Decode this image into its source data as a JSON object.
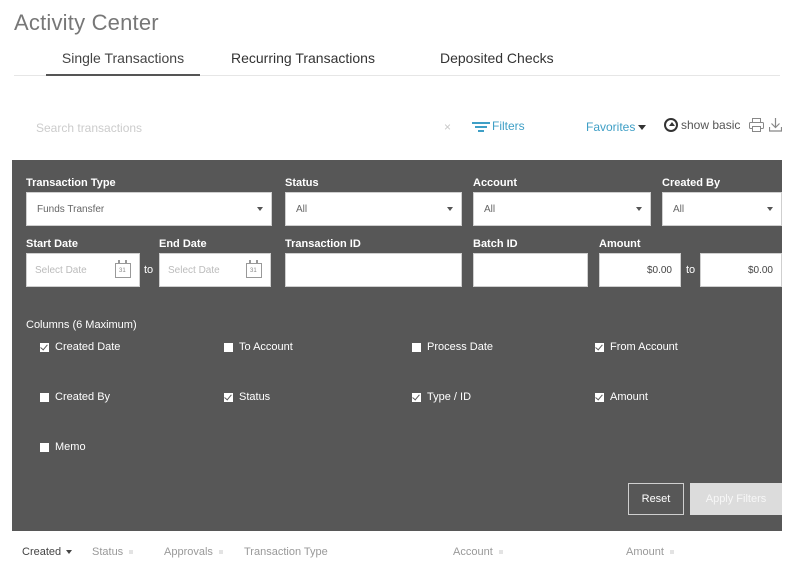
{
  "page": {
    "title": "Activity Center"
  },
  "tabs": [
    {
      "label": "Single Transactions",
      "active": true
    },
    {
      "label": "Recurring Transactions",
      "active": false
    },
    {
      "label": "Deposited Checks",
      "active": false
    }
  ],
  "toolbar": {
    "search_placeholder": "Search transactions",
    "clear_symbol": "×",
    "filters_label": "Filters",
    "favorites_label": "Favorites",
    "show_basic_label": "show basic"
  },
  "filters": {
    "transaction_type": {
      "label": "Transaction Type",
      "value": "Funds Transfer"
    },
    "status": {
      "label": "Status",
      "value": "All"
    },
    "account": {
      "label": "Account",
      "value": "All"
    },
    "created_by": {
      "label": "Created By",
      "value": "All"
    },
    "start_date": {
      "label": "Start Date",
      "placeholder": "Select Date"
    },
    "end_date": {
      "label": "End Date",
      "placeholder": "Select Date"
    },
    "transaction_id": {
      "label": "Transaction ID"
    },
    "batch_id": {
      "label": "Batch ID"
    },
    "amount": {
      "label": "Amount",
      "min": "$0.00",
      "max": "$0.00"
    },
    "to_label": "to",
    "columns_label": "Columns (6 Maximum)",
    "columns": [
      {
        "label": "Created Date",
        "checked": true
      },
      {
        "label": "To Account",
        "checked": false
      },
      {
        "label": "Process Date",
        "checked": false
      },
      {
        "label": "From Account",
        "checked": true
      },
      {
        "label": "Created By",
        "checked": false
      },
      {
        "label": "Status",
        "checked": true
      },
      {
        "label": "Type / ID",
        "checked": true
      },
      {
        "label": "Amount",
        "checked": true
      },
      {
        "label": "Memo",
        "checked": false
      }
    ],
    "reset_label": "Reset",
    "apply_label": "Apply Filters"
  },
  "table_headers": [
    {
      "label": "Created",
      "active": true
    },
    {
      "label": "Status",
      "active": false
    },
    {
      "label": "Approvals",
      "active": false
    },
    {
      "label": "Transaction Type",
      "active": false
    },
    {
      "label": "Account",
      "active": false
    },
    {
      "label": "Amount",
      "active": false
    }
  ],
  "colors": {
    "accent": "#3f9fc6",
    "panel": "#575757"
  }
}
